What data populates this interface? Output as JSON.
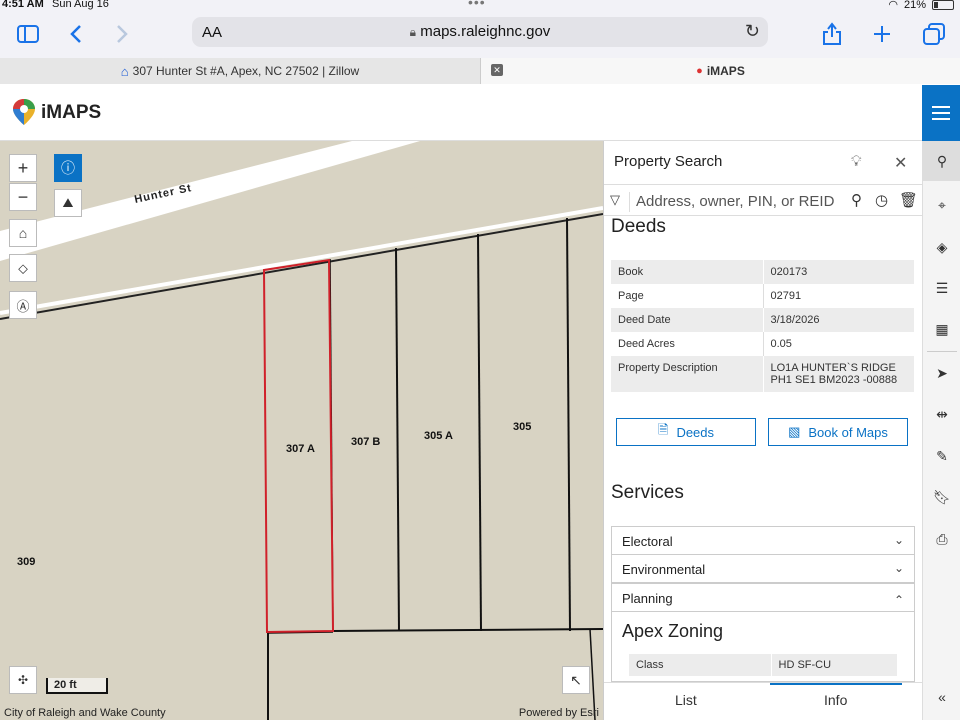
{
  "status_bar": {
    "time": "4:51 AM",
    "date": "Sun Aug 16",
    "battery": "21%"
  },
  "browser": {
    "aa_label": "AA",
    "url": "maps.raleighnc.gov",
    "tabs": [
      {
        "title": "307 Hunter St #A, Apex, NC 27502 | Zillow"
      },
      {
        "title": "iMAPS"
      }
    ]
  },
  "app": {
    "name": "iMAPS"
  },
  "map": {
    "street_label": "Hunter St",
    "parcels": [
      "307 A",
      "307 B",
      "305 A",
      "305",
      "309"
    ],
    "scale_label": "20 ft",
    "attribution_left": "City of Raleigh and Wake County",
    "attribution_right": "Powered by Esri",
    "controls": {
      "zoom_in": "+",
      "zoom_out": "−"
    }
  },
  "panel": {
    "title": "Property Search",
    "search_placeholder": "Address, owner, PIN, or REID",
    "deeds_heading": "Deeds",
    "deeds": [
      {
        "label": "Book",
        "value": "020173"
      },
      {
        "label": "Page",
        "value": "02791"
      },
      {
        "label": "Deed Date",
        "value": "3/18/2026"
      },
      {
        "label": "Deed Acres",
        "value": "0.05"
      },
      {
        "label": "Property Description",
        "value": "LO1A HUNTER`S RIDGE PH1 SE1 BM2023 -00888"
      }
    ],
    "buttons": {
      "deeds": "Deeds",
      "book_of_maps": "Book of Maps"
    },
    "services_heading": "Services",
    "accordions": [
      "Electoral",
      "Environmental",
      "Planning"
    ],
    "zoning_heading": "Apex Zoning",
    "zoning": [
      {
        "label": "Class",
        "value": "HD SF-CU"
      }
    ],
    "bottom_tabs": {
      "list": "List",
      "info": "Info"
    }
  },
  "colors": {
    "accent": "#0a72c5",
    "parcel_highlight": "#d0202a",
    "map_bg": "#d8d3c3"
  }
}
